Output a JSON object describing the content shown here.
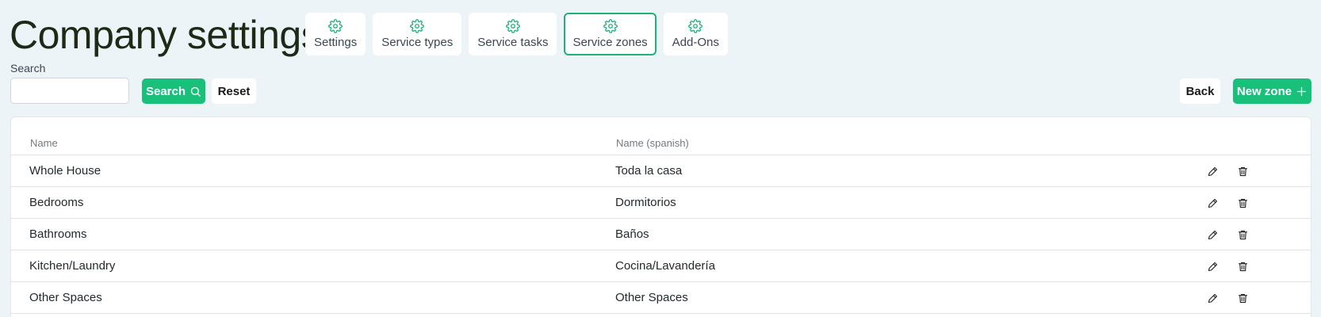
{
  "page": {
    "title": "Company settings"
  },
  "tabs": [
    {
      "label": "Settings",
      "icon": "gear-icon",
      "active": false
    },
    {
      "label": "Service types",
      "icon": "gear-icon",
      "active": false
    },
    {
      "label": "Service tasks",
      "icon": "gear-icon",
      "active": false
    },
    {
      "label": "Service zones",
      "icon": "gear-icon",
      "active": true
    },
    {
      "label": "Add-Ons",
      "icon": "gear-icon",
      "active": false
    }
  ],
  "search": {
    "label": "Search",
    "value": "",
    "placeholder": "",
    "search_button": "Search",
    "reset_button": "Reset"
  },
  "actions": {
    "back_button": "Back",
    "new_button": "New zone"
  },
  "table": {
    "columns": [
      "Name",
      "Name (spanish)"
    ],
    "rows": [
      {
        "name": "Whole House",
        "spanish": "Toda la casa"
      },
      {
        "name": "Bedrooms",
        "spanish": "Dormitorios"
      },
      {
        "name": "Bathrooms",
        "spanish": "Baños"
      },
      {
        "name": "Kitchen/Laundry",
        "spanish": "Cocina/Lavandería"
      },
      {
        "name": "Other Spaces",
        "spanish": "Other Spaces"
      }
    ]
  },
  "colors": {
    "accent": "#18c07a",
    "background": "#edf4f7",
    "title": "#1c2a16"
  }
}
